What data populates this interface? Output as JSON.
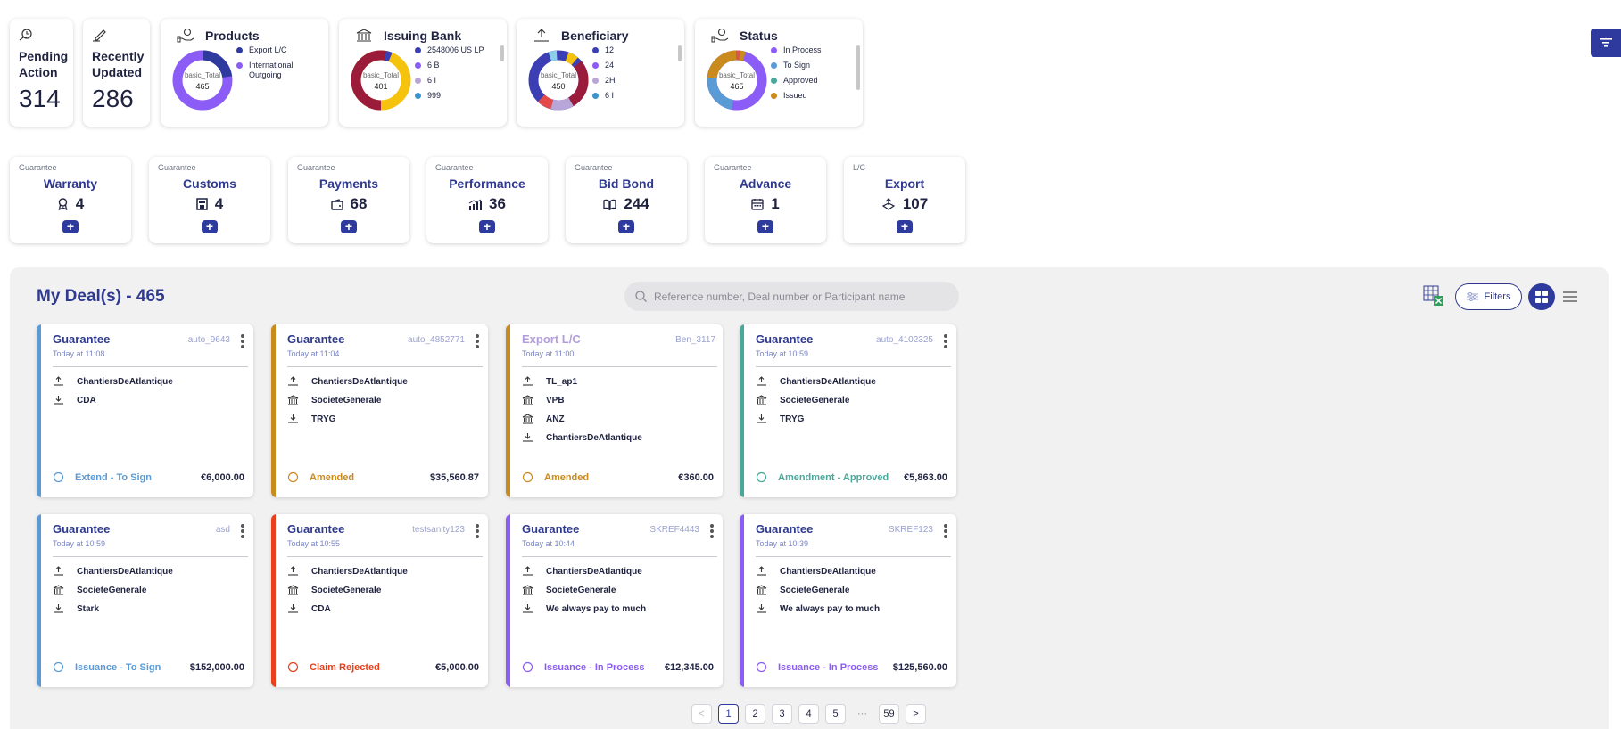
{
  "summary": {
    "pending": {
      "label_line1": "Pending",
      "label_line2": "Action",
      "value": "314"
    },
    "recent": {
      "label_line1": "Recently",
      "label_line2": "Updated",
      "value": "286"
    }
  },
  "charts": {
    "products": {
      "title": "Products",
      "center_label": "basic_Total",
      "center_value": "465",
      "legend": [
        {
          "label": "Export L/C",
          "color": "#2f3a9f"
        },
        {
          "label": "International Outgoing",
          "color": "#8b5cf6"
        }
      ]
    },
    "issuing_bank": {
      "title": "Issuing Bank",
      "center_label": "basic_Total",
      "center_value": "401",
      "legend": [
        {
          "label": "2548006 US LP",
          "color": "#3b3fb3"
        },
        {
          "label": "6 B",
          "color": "#8b5cf6"
        },
        {
          "label": "6 I",
          "color": "#b9a6d8"
        },
        {
          "label": "999",
          "color": "#3b94c9"
        }
      ]
    },
    "beneficiary": {
      "title": "Beneficiary",
      "center_label": "basic_Total",
      "center_value": "450",
      "legend": [
        {
          "label": "12",
          "color": "#3b3fb3"
        },
        {
          "label": "24",
          "color": "#8b5cf6"
        },
        {
          "label": "2H",
          "color": "#b9a6d8"
        },
        {
          "label": "6 I",
          "color": "#3b94c9"
        }
      ]
    },
    "status": {
      "title": "Status",
      "center_label": "basic_Total",
      "center_value": "465",
      "legend": [
        {
          "label": "In Process",
          "color": "#8b5cf6"
        },
        {
          "label": "To Sign",
          "color": "#5b9bd5"
        },
        {
          "label": "Approved",
          "color": "#4aa89a"
        },
        {
          "label": "Issued",
          "color": "#c98a1e"
        }
      ]
    }
  },
  "categories": [
    {
      "type": "Guarantee",
      "name": "Warranty",
      "count": "4",
      "icon": "ribbon-icon"
    },
    {
      "type": "Guarantee",
      "name": "Customs",
      "count": "4",
      "icon": "building-icon"
    },
    {
      "type": "Guarantee",
      "name": "Payments",
      "count": "68",
      "icon": "wallet-icon"
    },
    {
      "type": "Guarantee",
      "name": "Performance",
      "count": "36",
      "icon": "chart-icon"
    },
    {
      "type": "Guarantee",
      "name": "Bid Bond",
      "count": "244",
      "icon": "book-icon"
    },
    {
      "type": "Guarantee",
      "name": "Advance",
      "count": "1",
      "icon": "calendar-icon"
    },
    {
      "type": "L/C",
      "name": "Export",
      "count": "107",
      "icon": "export-icon"
    }
  ],
  "deals_section": {
    "title": "My Deal(s) - 465",
    "search_placeholder": "Reference number, Deal number or Participant name",
    "filters_label": "Filters"
  },
  "deals": [
    {
      "type": "Guarantee",
      "time": "Today at 11:08",
      "ref": "auto_9643",
      "parties": [
        "ChantiersDeAtlantique",
        "CDA"
      ],
      "status": "Extend - To Sign",
      "amount": "€6,000.00",
      "color": "#5b9bd5"
    },
    {
      "type": "Guarantee",
      "time": "Today at 11:04",
      "ref": "auto_4852771",
      "parties": [
        "ChantiersDeAtlantique",
        "SocieteGenerale",
        "TRYG"
      ],
      "status": "Amended",
      "amount": "$35,560.87",
      "color": "#c98a1e"
    },
    {
      "type": "Export L/C",
      "time": "Today at 11:00",
      "ref": "Ben_3117",
      "parties": [
        "TL_ap1",
        "VPB",
        "ANZ",
        "ChantiersDeAtlantique"
      ],
      "status": "Amended",
      "amount": "€360.00",
      "color": "#c98a1e"
    },
    {
      "type": "Guarantee",
      "time": "Today at 10:59",
      "ref": "auto_4102325",
      "parties": [
        "ChantiersDeAtlantique",
        "SocieteGenerale",
        "TRYG"
      ],
      "status": "Amendment - Approved",
      "amount": "€5,863.00",
      "color": "#4aa89a"
    },
    {
      "type": "Guarantee",
      "time": "Today at 10:59",
      "ref": "asd",
      "parties": [
        "ChantiersDeAtlantique",
        "SocieteGenerale",
        "Stark"
      ],
      "status": "Issuance - To Sign",
      "amount": "$152,000.00",
      "color": "#5b9bd5"
    },
    {
      "type": "Guarantee",
      "time": "Today at 10:55",
      "ref": "testsanity123",
      "parties": [
        "ChantiersDeAtlantique",
        "SocieteGenerale",
        "CDA"
      ],
      "status": "Claim Rejected",
      "amount": "€5,000.00",
      "color": "#e8401c"
    },
    {
      "type": "Guarantee",
      "time": "Today at 10:44",
      "ref": "SKREF4443",
      "parties": [
        "ChantiersDeAtlantique",
        "SocieteGenerale",
        "We always pay to much"
      ],
      "status": "Issuance - In Process",
      "amount": "€12,345.00",
      "color": "#8b5cf6"
    },
    {
      "type": "Guarantee",
      "time": "Today at 10:39",
      "ref": "SKREF123",
      "parties": [
        "ChantiersDeAtlantique",
        "SocieteGenerale",
        "We always pay to much"
      ],
      "status": "Issuance - In Process",
      "amount": "$125,560.00",
      "color": "#8b5cf6"
    }
  ],
  "pagination": {
    "pages": [
      "1",
      "2",
      "3",
      "4",
      "5"
    ],
    "ellipsis": "···",
    "last": "59",
    "prev": "<",
    "next": ">"
  }
}
